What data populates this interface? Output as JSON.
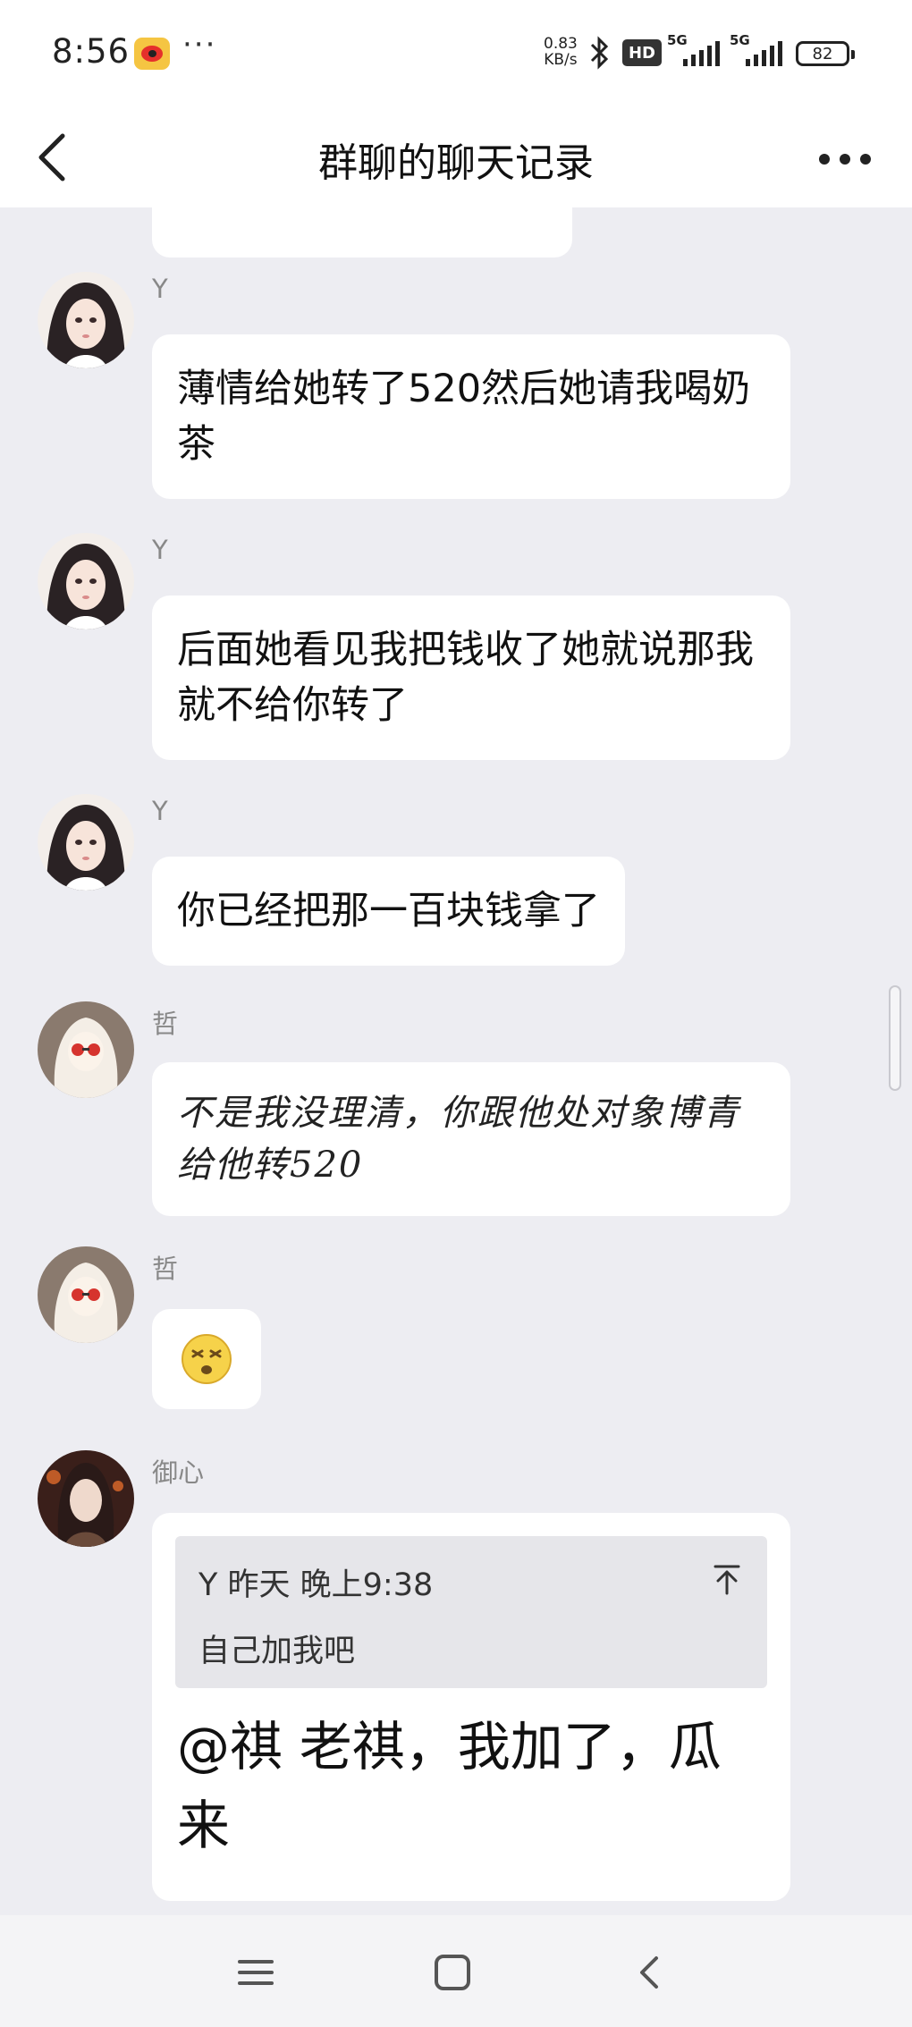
{
  "status_bar": {
    "time": "8:56",
    "more": "···",
    "net_speed_value": "0.83",
    "net_speed_unit": "KB/s",
    "hd_label": "HD",
    "signal_1_label": "5G",
    "signal_2_label": "5G",
    "battery": "82",
    "app_icon": "weibo-icon",
    "bluetooth_icon": "bluetooth-icon"
  },
  "nav": {
    "title": "群聊的聊天记录",
    "back_icon": "chevron-left-icon",
    "more_icon": "more-horizontal-icon"
  },
  "messages": [
    {
      "sender": "Y",
      "text": "薄情给她转了520然后她请我喝奶茶"
    },
    {
      "sender": "Y",
      "text": "后面她看见我把钱收了她就说那我就不给你转了"
    },
    {
      "sender": "Y",
      "text": "你已经把那一百块钱拿了"
    },
    {
      "sender": "哲",
      "text": "不是我没理清，你跟他处对象博青给他转520"
    },
    {
      "sender": "哲",
      "emoji": "😵"
    },
    {
      "sender": "御心",
      "quote": {
        "meta": "Y 昨天 晚上9:38",
        "text": "自己加我吧",
        "icon": "arrow-up-to-top-icon"
      },
      "text": "@祺 老祺，我加了，瓜来"
    }
  ],
  "bottom_nav": {
    "icons": [
      "menu-icon",
      "home-square-icon",
      "back-chevron-icon"
    ]
  },
  "colors": {
    "background": "#ededf2",
    "bubble": "#ffffff",
    "quote_bg": "#e6e6ea",
    "sender_text": "#888888"
  }
}
